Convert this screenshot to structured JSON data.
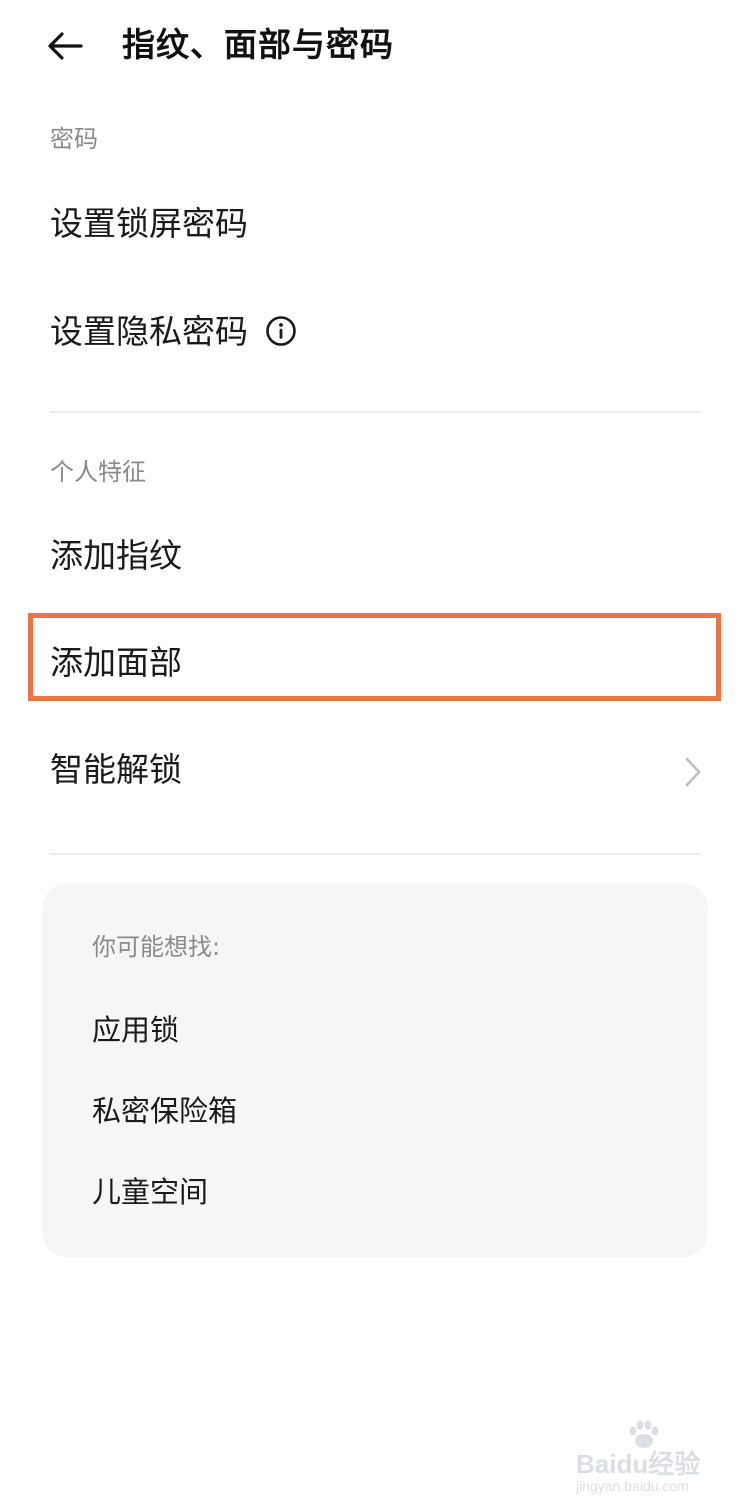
{
  "header": {
    "title": "指纹、面部与密码"
  },
  "sections": {
    "password": {
      "label": "密码",
      "items": [
        {
          "label": "设置锁屏密码"
        },
        {
          "label": "设置隐私密码"
        }
      ]
    },
    "biometrics": {
      "label": "个人特征",
      "items": [
        {
          "label": "添加指纹"
        },
        {
          "label": "添加面部"
        },
        {
          "label": "智能解锁"
        }
      ]
    }
  },
  "suggestions": {
    "title": "你可能想找:",
    "items": [
      {
        "label": "应用锁"
      },
      {
        "label": "私密保险箱"
      },
      {
        "label": "儿童空间"
      }
    ]
  },
  "watermark": {
    "brand": "Baidu经验",
    "url": "jingyan.baidu.com"
  },
  "colors": {
    "highlight": "#ec7446",
    "card_bg": "#f6f6f6",
    "divider": "#ececec",
    "secondary_text": "#8a8a8a"
  },
  "icons": {
    "back": "arrow-left-icon",
    "info": "info-circle-icon",
    "chevron": "chevron-right-icon"
  }
}
